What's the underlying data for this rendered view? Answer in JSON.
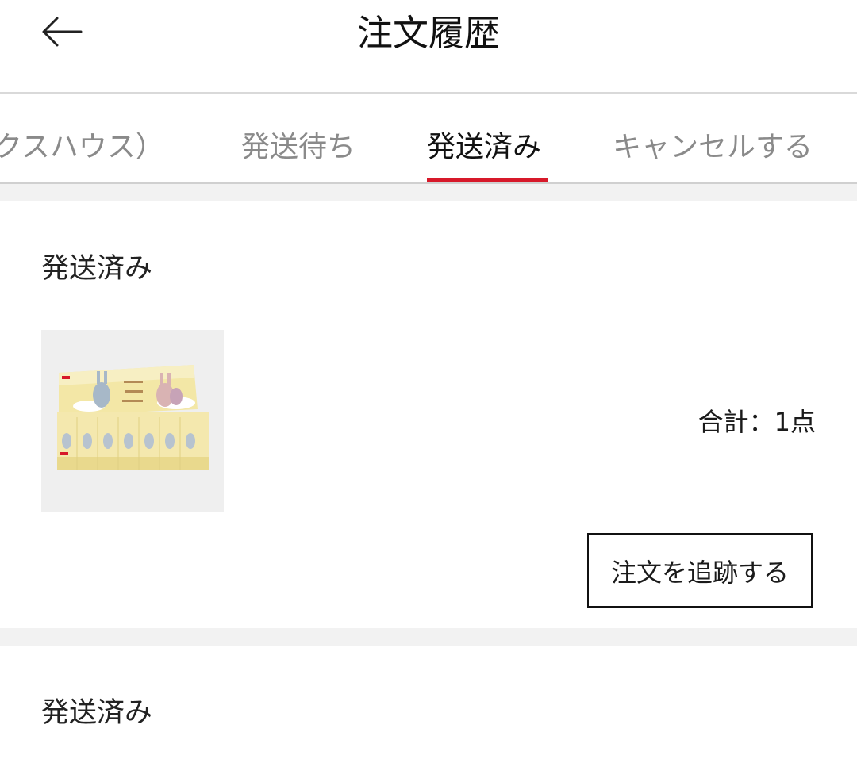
{
  "header": {
    "title": "注文履歴",
    "back_icon": "arrow-left-icon"
  },
  "tabs": [
    {
      "label": "クスハウス）",
      "active": false
    },
    {
      "label": "発送待ち",
      "active": false
    },
    {
      "label": "発送済み",
      "active": true
    },
    {
      "label": "キャンセルする",
      "active": false
    }
  ],
  "colors": {
    "accent": "#d7192a",
    "separator": "#f2f2f2",
    "inactive_tab": "#8a8a8a"
  },
  "orders": [
    {
      "status": "発送済み",
      "product_image": "product-box-thumbnail",
      "total": "合計：1点",
      "track_button": "注文を追跡する"
    },
    {
      "status": "発送済み"
    }
  ]
}
